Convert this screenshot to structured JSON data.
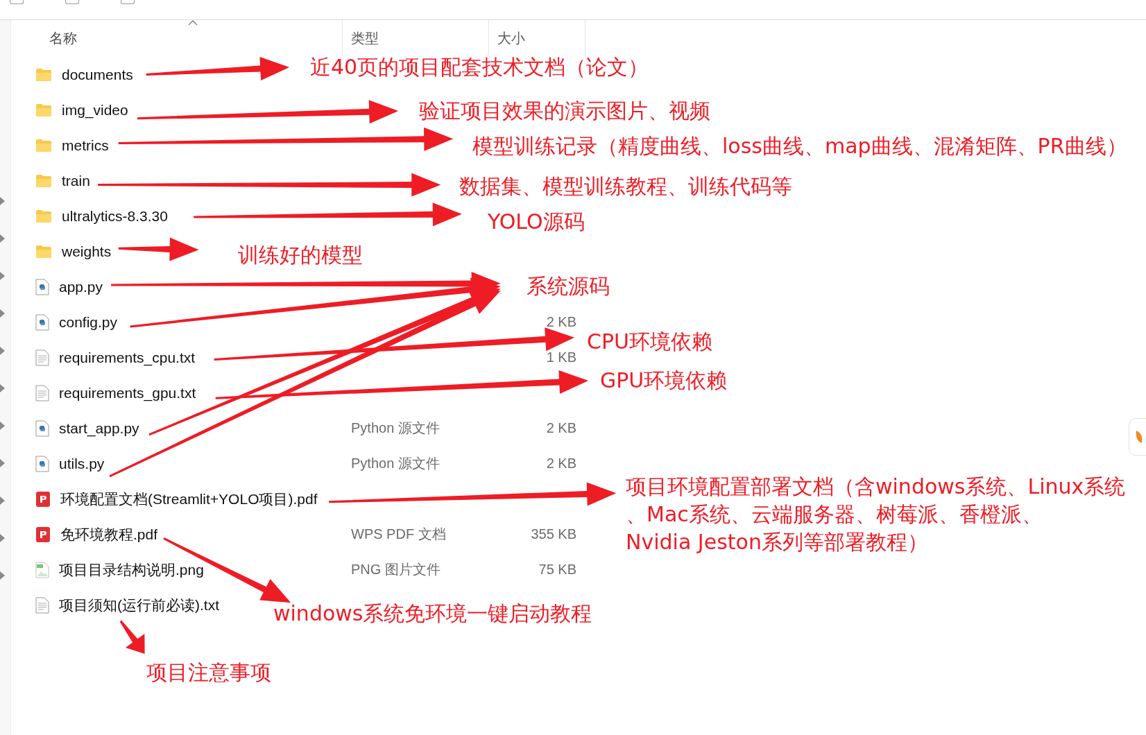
{
  "columns": [
    {
      "label": "名称",
      "sorted": true
    },
    {
      "label": "类型",
      "sorted": false
    },
    {
      "label": "大小",
      "sorted": false
    }
  ],
  "files": [
    {
      "kind": "folder",
      "name": "documents"
    },
    {
      "kind": "folder",
      "name": "img_video"
    },
    {
      "kind": "folder",
      "name": "metrics"
    },
    {
      "kind": "folder",
      "name": "train"
    },
    {
      "kind": "folder",
      "name": "ultralytics-8.3.30"
    },
    {
      "kind": "folder",
      "name": "weights"
    },
    {
      "kind": "python",
      "name": "app.py"
    },
    {
      "kind": "python",
      "name": "config.py",
      "size": "2 KB"
    },
    {
      "kind": "text",
      "name": "requirements_cpu.txt",
      "size": "1 KB"
    },
    {
      "kind": "text",
      "name": "requirements_gpu.txt"
    },
    {
      "kind": "python",
      "name": "start_app.py",
      "type": "Python 源文件",
      "size": "2 KB"
    },
    {
      "kind": "python",
      "name": "utils.py",
      "type": "Python 源文件",
      "size": "2 KB"
    },
    {
      "kind": "pdf",
      "name": "环境配置文档(Streamlit+YOLO项目).pdf"
    },
    {
      "kind": "pdf",
      "name": "免环境教程.pdf",
      "type": "WPS PDF 文档",
      "size": "355 KB"
    },
    {
      "kind": "image",
      "name": "项目目录结构说明.png",
      "type": "PNG 图片文件",
      "size": "75 KB"
    },
    {
      "kind": "text",
      "name": "项目须知(运行前必读).txt"
    }
  ],
  "annotations": [
    {
      "lines": [
        "近40页的项目配套技术文档（论文）"
      ]
    },
    {
      "lines": [
        "验证项目效果的演示图片、视频"
      ]
    },
    {
      "lines": [
        "模型训练记录（精度曲线、loss曲线、map曲线、混淆矩阵、PR曲线）"
      ]
    },
    {
      "lines": [
        "数据集、模型训练教程、训练代码等"
      ]
    },
    {
      "lines": [
        "YOLO源码"
      ]
    },
    {
      "lines": [
        "训练好的模型"
      ]
    },
    {
      "lines": [
        "系统源码"
      ]
    },
    {
      "lines": [
        "CPU环境依赖"
      ]
    },
    {
      "lines": [
        "GPU环境依赖"
      ]
    },
    {
      "lines": [
        "项目环境配置部署文档（含windows系统、Linux系统",
        "、Mac系统、云端服务器、树莓派、香橙派、",
        "Nvidia Jeston系列等部署教程）"
      ]
    },
    {
      "lines": [
        "windows系统免环境一键启动教程"
      ]
    },
    {
      "lines": [
        "项目注意事项"
      ]
    }
  ]
}
